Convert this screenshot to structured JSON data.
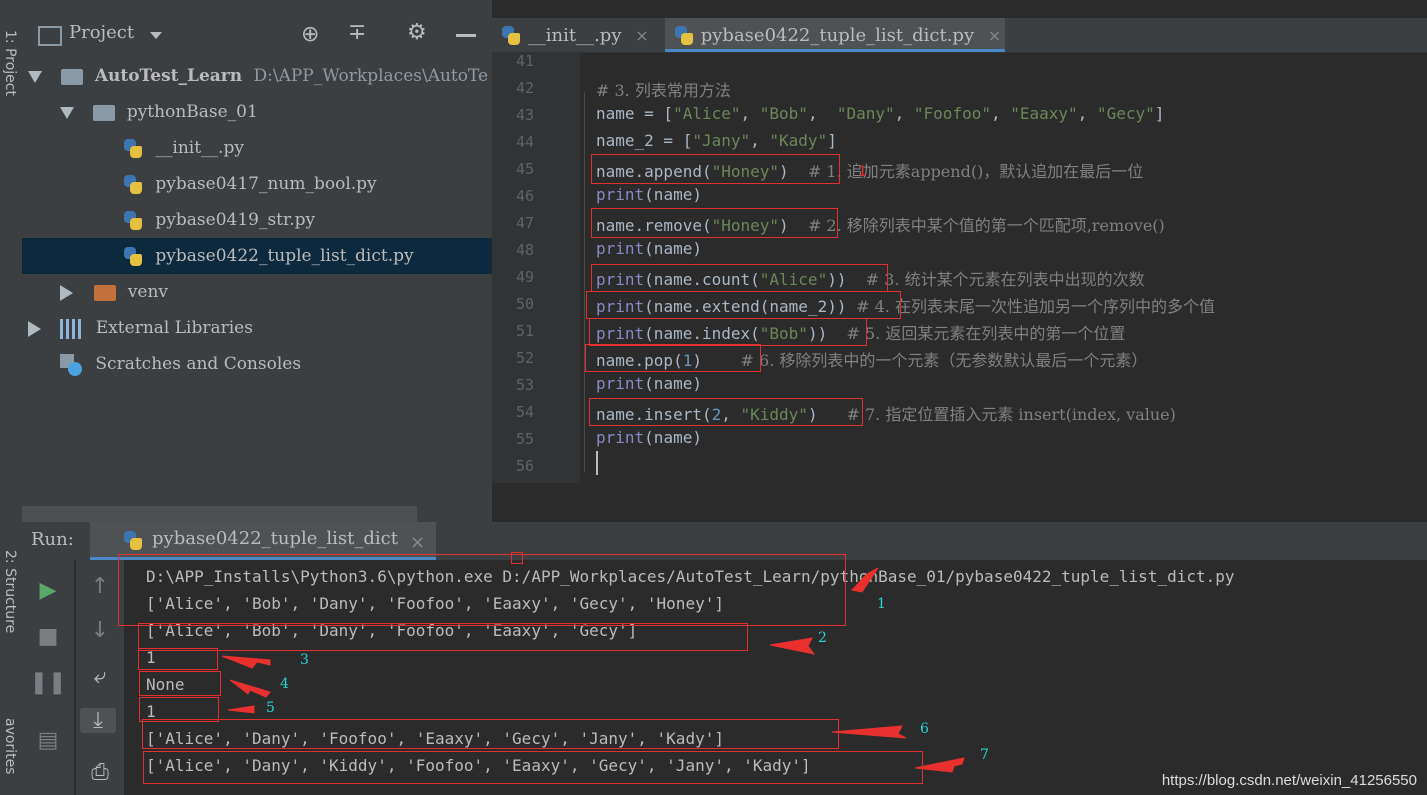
{
  "left_strip": {
    "project_tab": "1: Project",
    "structure_tab": "2: Structure",
    "favorites_tab": "avorites"
  },
  "project_panel": {
    "title": "Project",
    "tree": [
      {
        "label": "AutoTest_Learn",
        "path": "D:\\APP_Workplaces\\AutoTe"
      },
      {
        "label": "pythonBase_01"
      },
      {
        "label": "__init__.py"
      },
      {
        "label": "pybase0417_num_bool.py"
      },
      {
        "label": "pybase0419_str.py"
      },
      {
        "label": "pybase0422_tuple_list_dict.py"
      },
      {
        "label": "venv"
      },
      {
        "label": "External Libraries"
      },
      {
        "label": "Scratches and Consoles"
      }
    ]
  },
  "editor": {
    "tabs": [
      {
        "label": "__init__.py",
        "close": "×"
      },
      {
        "label": "pybase0422_tuple_list_dict.py",
        "close": "×"
      }
    ],
    "line_numbers": [
      "41",
      "42",
      "43",
      "44",
      "45",
      "46",
      "47",
      "48",
      "49",
      "50",
      "51",
      "52",
      "53",
      "54",
      "55",
      "56"
    ],
    "code": {
      "l42": "# 3. 列表常用方法",
      "l43_a": "name = [",
      "l43_s1": "\"Alice\"",
      "l43_s2": "\"Bob\"",
      "l43_s3": "\"Dany\"",
      "l43_s4": "\"Foofoo\"",
      "l43_s5": "\"Eaaxy\"",
      "l43_s6": "\"Gecy\"",
      "l44_a": "name_2 = [",
      "l44_s1": "\"Jany\"",
      "l44_s2": "\"Kady\"",
      "l45_a": "name.append(",
      "l45_s": "\"Honey\"",
      "l45_c": "# 1. 追加元素append()，默认追加在最后一位",
      "l45_mark": "1",
      "print": "print",
      "l46_b": "(name)",
      "l47_a": "name.remove(",
      "l47_s": "\"Honey\"",
      "l47_c": "# 2. 移除列表中某个值的第一个匹配项,remove()",
      "l49_b": "(name.count(",
      "l49_s": "\"Alice\"",
      "l49_c": "# 3. 统计某个元素在列表中出现的次数",
      "l50_b": "(name.extend(name_2))",
      "l50_c": "# 4. 在列表末尾一次性追加另一个序列中的多个值",
      "l51_b": "(name.index(",
      "l51_s": "\"Bob\"",
      "l51_c": "# 5. 返回某元素在列表中的第一个位置",
      "l52_a": "name.pop(",
      "l52_n": "1",
      "l52_c": "# 6. 移除列表中的一个元素（无参数默认最后一个元素）",
      "l54_a": "name.insert(",
      "l54_n": "2",
      "l54_s": "\"Kiddy\"",
      "l54_c": "# 7. 指定位置插入元素 insert(index, value)"
    }
  },
  "run_panel": {
    "label": "Run:",
    "tab": "pybase0422_tuple_list_dict",
    "tab_close": "×",
    "output": [
      "D:\\APP_Installs\\Python3.6\\python.exe D:/APP_Workplaces/AutoTest_Learn/pythonBase_01/pybase0422_tuple_list_dict.py",
      "['Alice', 'Bob', 'Dany', 'Foofoo', 'Eaaxy', 'Gecy', 'Honey']",
      "['Alice', 'Bob', 'Dany', 'Foofoo', 'Eaaxy', 'Gecy']",
      "1",
      "None",
      "1",
      "['Alice', 'Dany', 'Foofoo', 'Eaaxy', 'Gecy', 'Jany', 'Kady']",
      "['Alice', 'Dany', 'Kiddy', 'Foofoo', 'Eaaxy', 'Gecy', 'Jany', 'Kady']"
    ],
    "annotations": [
      "1",
      "2",
      "3",
      "4",
      "5",
      "6",
      "7"
    ]
  },
  "watermark": "https://blog.csdn.net/weixin_41256550",
  "colors": {
    "red_annotation": "#e0302f",
    "cyan_annotation": "#29d4d4",
    "selection": "#0d293e"
  }
}
